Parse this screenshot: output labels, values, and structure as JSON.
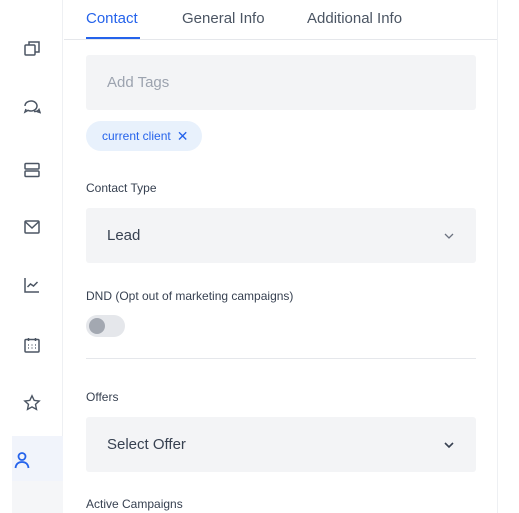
{
  "tabs": [
    {
      "label": "Contact"
    },
    {
      "label": "General Info"
    },
    {
      "label": "Additional Info"
    }
  ],
  "rail": {
    "icons": [
      "copy-icon",
      "chat-icon",
      "server-icon",
      "mail-icon",
      "chart-icon",
      "calendar-icon",
      "star-icon",
      "user-icon"
    ],
    "active": "user-icon"
  },
  "form": {
    "tags": {
      "placeholder": "Add Tags",
      "chips": [
        {
          "label": "current client"
        }
      ],
      "remove_symbol": "✕"
    },
    "contact_type": {
      "label": "Contact Type",
      "value": "Lead"
    },
    "dnd": {
      "label": "DND (Opt out of marketing campaigns)",
      "enabled": false
    },
    "offers": {
      "label": "Offers",
      "value": "Select Offer"
    },
    "active_campaigns": {
      "label": "Active Campaigns"
    }
  },
  "colors": {
    "accent": "#2563eb",
    "field_bg": "#f3f4f6",
    "chip_bg": "#e8f1fc"
  }
}
